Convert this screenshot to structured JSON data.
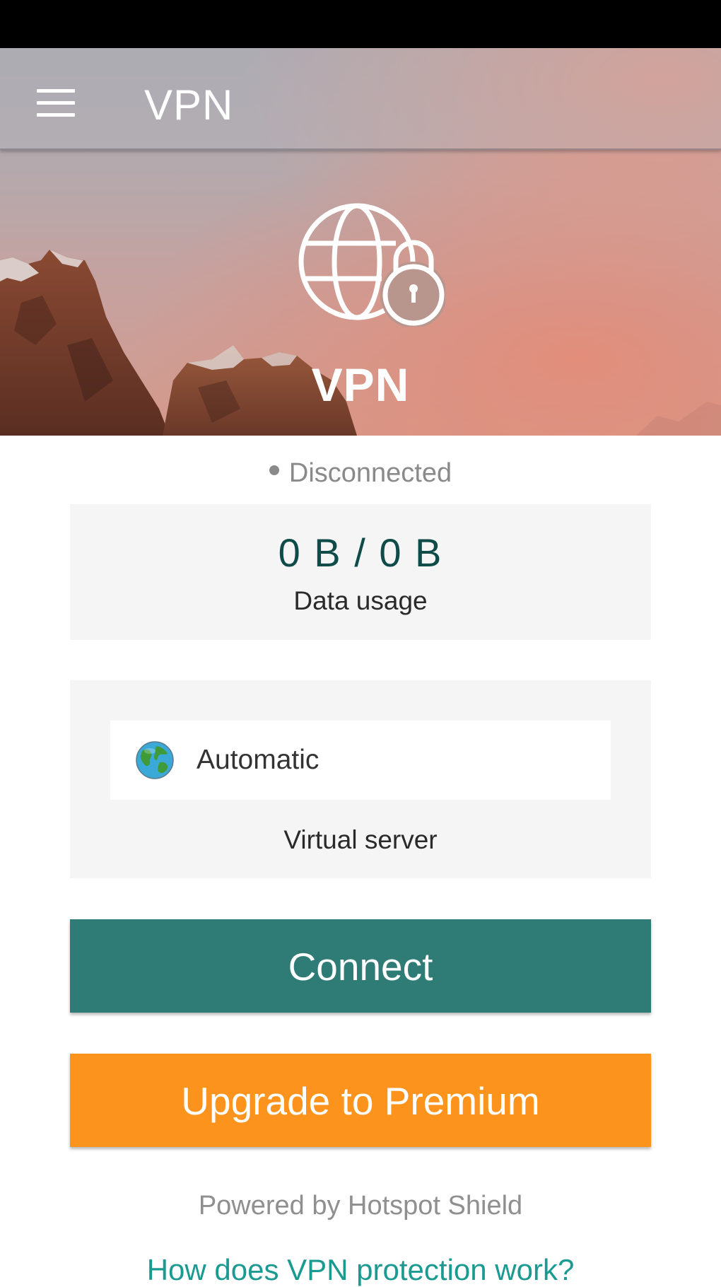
{
  "toolbar": {
    "menu_icon": "hamburger-menu-icon",
    "title": "VPN"
  },
  "hero": {
    "icon": "globe-lock-icon",
    "title": "VPN"
  },
  "status": {
    "text": "Disconnected",
    "dot_color": "#8a8a8a"
  },
  "usage": {
    "value": "0 B / 0 B",
    "label": "Data usage"
  },
  "server": {
    "icon": "earth-globe-icon",
    "value": "Automatic",
    "label": "Virtual server"
  },
  "actions": {
    "connect_label": "Connect",
    "upgrade_label": "Upgrade to Premium"
  },
  "footer": {
    "powered_by": "Powered by Hotspot Shield",
    "help_link": "How does VPN protection work?"
  },
  "colors": {
    "connect_button": "#2f7c76",
    "upgrade_button": "#fb931c",
    "link": "#1b9a91",
    "usage_value": "#0f4b48"
  }
}
